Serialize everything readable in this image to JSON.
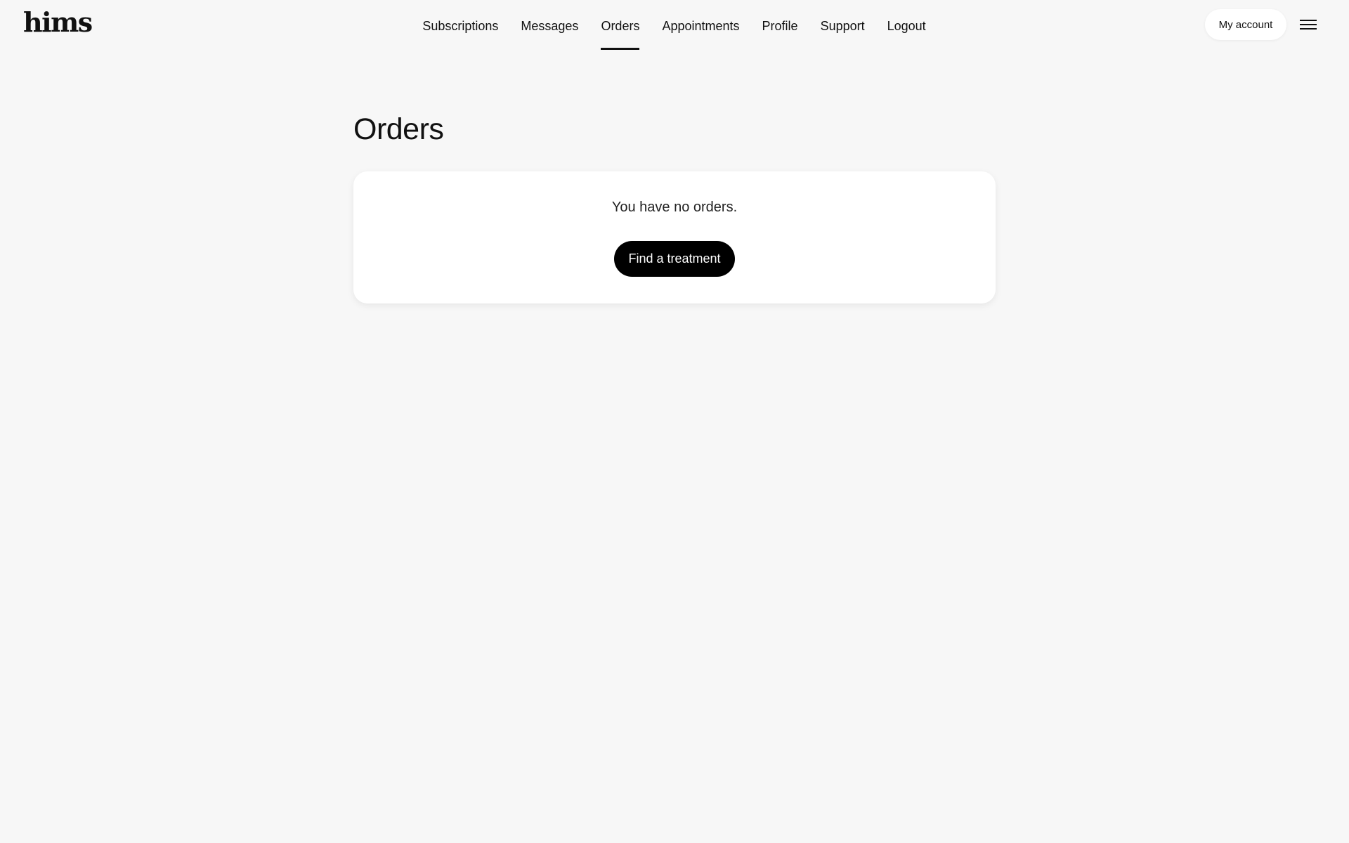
{
  "brand": {
    "logo_text": "hims"
  },
  "nav": {
    "items": [
      {
        "label": "Subscriptions"
      },
      {
        "label": "Messages"
      },
      {
        "label": "Orders",
        "active": true
      },
      {
        "label": "Appointments"
      },
      {
        "label": "Profile"
      },
      {
        "label": "Support"
      },
      {
        "label": "Logout"
      }
    ]
  },
  "header": {
    "account_label": "My account",
    "menu_icon": "hamburger-menu-icon"
  },
  "main": {
    "title": "Orders",
    "empty_state": {
      "message": "You have no orders.",
      "cta_label": "Find a treatment"
    }
  },
  "colors": {
    "background": "#f7f7f7",
    "card": "#ffffff",
    "text": "#111111",
    "button": "#000000",
    "button_text": "#ffffff"
  }
}
